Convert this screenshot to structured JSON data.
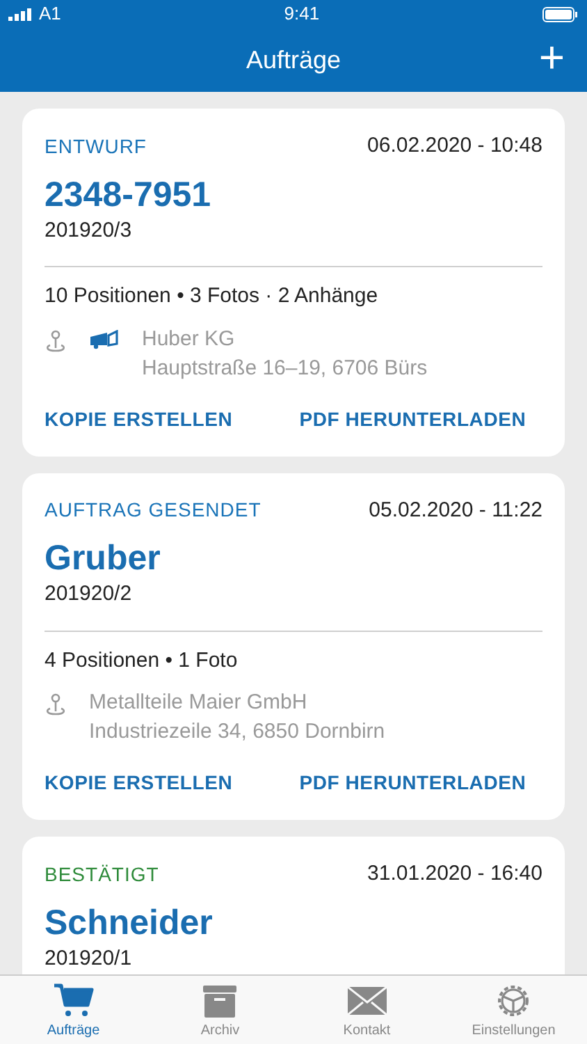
{
  "status_bar": {
    "carrier": "A1",
    "time": "9:41"
  },
  "nav": {
    "title": "Aufträge",
    "add": "+"
  },
  "orders": [
    {
      "status": "ENTWURF",
      "color": "#1a74b8",
      "date": "06.02.2020 - 10:48",
      "title": "2348-7951",
      "number": "201920/3",
      "meta": "10 Positionen • 3 Fotos · 2 Anhänge",
      "delivery_icon": true,
      "company": "Huber KG",
      "address": "Hauptstraße 16–19, 6706 Bürs",
      "actions": [
        "KOPIE ERSTELLEN",
        "PDF HERUNTERLADEN"
      ]
    },
    {
      "status": "AUFTRAG GESENDET",
      "color": "#1a74b8",
      "date": "05.02.2020 - 11:22",
      "title": "Gruber",
      "number": "201920/2",
      "meta": "4 Positionen • 1 Foto",
      "delivery_icon": false,
      "company": "Metallteile Maier GmbH",
      "address": "Industriezeile 34, 6850 Dornbirn",
      "actions": [
        "KOPIE ERSTELLEN",
        "PDF HERUNTERLADEN"
      ]
    },
    {
      "status": "BESTÄTIGT",
      "color": "#2e8b3a",
      "date": "31.01.2020 - 16:40",
      "title": "Schneider",
      "number": "201920/1"
    }
  ],
  "tabs": [
    {
      "label": "Aufträge",
      "kind": "cart",
      "selected": true
    },
    {
      "label": "Archiv",
      "kind": "archive",
      "selected": false
    },
    {
      "label": "Kontakt",
      "kind": "mail",
      "selected": false
    },
    {
      "label": "Einstellungen",
      "kind": "gear",
      "selected": false
    }
  ]
}
